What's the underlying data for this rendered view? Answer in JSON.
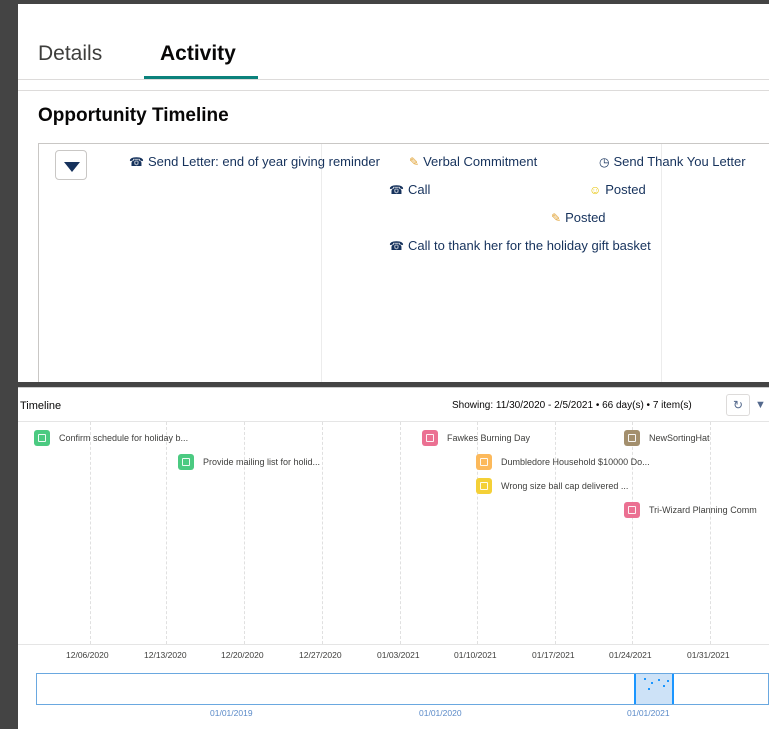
{
  "tabs": [
    {
      "label": "Details",
      "active": false
    },
    {
      "label": "Activity",
      "active": true
    }
  ],
  "opportunity_timeline": {
    "title": "Opportunity Timeline",
    "events": [
      {
        "label": "Send Letter: end of year giving reminder",
        "icon": "phone-icon"
      },
      {
        "label": "Verbal Commitment",
        "icon": "pencil-icon"
      },
      {
        "label": "Send Thank You Letter",
        "icon": "clock-icon"
      },
      {
        "label": "Call",
        "icon": "phone-icon"
      },
      {
        "label": "Posted",
        "icon": "smiley-icon"
      },
      {
        "label": "Posted",
        "icon": "pencil-icon"
      },
      {
        "label": "Call to thank her for the holiday gift basket",
        "icon": "phone-icon"
      }
    ]
  },
  "timeline": {
    "title": "Timeline",
    "showing": "Showing: 11/30/2020 - 2/5/2021 • 66 day(s) • 7 item(s)",
    "items": [
      {
        "label": "Confirm schedule for holiday b...",
        "color": "#4bca81"
      },
      {
        "label": "Provide mailing list for holid...",
        "color": "#4bca81"
      },
      {
        "label": "Fawkes Burning Day",
        "color": "#eb7092"
      },
      {
        "label": "NewSortingHat",
        "color": "#a38f6d"
      },
      {
        "label": "Dumbledore Household $10000 Do...",
        "color": "#fcb95b"
      },
      {
        "label": "Wrong size ball cap delivered ...",
        "color": "#f4d037"
      },
      {
        "label": "Tri-Wizard Planning Comm",
        "color": "#eb7092"
      }
    ],
    "axis_ticks": [
      "12/06/2020",
      "12/13/2020",
      "12/20/2020",
      "12/27/2020",
      "01/03/2021",
      "01/10/2021",
      "01/17/2021",
      "01/24/2021",
      "01/31/2021"
    ],
    "overview_ticks": [
      "01/01/2019",
      "01/01/2020",
      "01/01/2021"
    ]
  }
}
